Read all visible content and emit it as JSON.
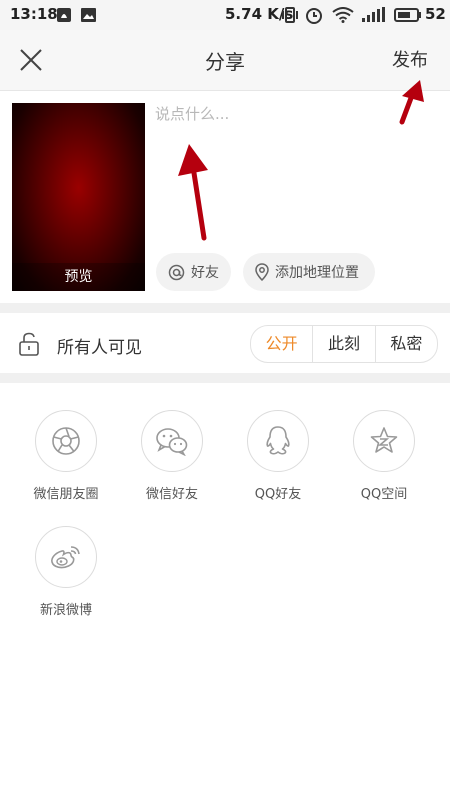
{
  "status_bar": {
    "time": "13:18",
    "network_speed": "5.74 K/s",
    "battery": "52"
  },
  "header": {
    "title": "分享",
    "publish_label": "发布"
  },
  "compose": {
    "preview_label": "预览",
    "placeholder": "说点什么...",
    "friends_label": "好友",
    "location_label": "添加地理位置"
  },
  "visibility": {
    "label": "所有人可见",
    "options": [
      "公开",
      "此刻",
      "私密"
    ],
    "selected": "公开",
    "accent_color": "#ee8a2a"
  },
  "share_targets": [
    {
      "label": "微信朋友圈",
      "icon": "wechat-moments-icon"
    },
    {
      "label": "微信好友",
      "icon": "wechat-icon"
    },
    {
      "label": "QQ好友",
      "icon": "qq-icon"
    },
    {
      "label": "QQ空间",
      "icon": "qzone-icon"
    },
    {
      "label": "新浪微博",
      "icon": "weibo-icon"
    }
  ],
  "annotation_color": "#b5000e"
}
